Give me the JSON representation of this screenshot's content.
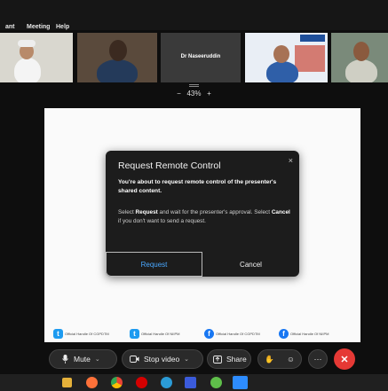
{
  "menu": {
    "items": [
      "ant",
      "Meeting",
      "Help"
    ]
  },
  "participants": [
    {
      "name": "",
      "video": true
    },
    {
      "name": "",
      "video": true
    },
    {
      "name": "Dr Naseeruddin",
      "video": false
    },
    {
      "name": "",
      "video": true
    },
    {
      "name": "",
      "video": true
    }
  ],
  "zoom": {
    "minus": "−",
    "level": "43%",
    "plus": "+"
  },
  "shared_footer": {
    "logos": [
      {
        "icon": "twitter-icon",
        "label": "Official Handle Of CGPDTM"
      },
      {
        "icon": "twitter-icon",
        "label": "Official Handle Of NIIPM"
      },
      {
        "icon": "facebook-icon",
        "label": "Official Handle Of CGPDTM"
      },
      {
        "icon": "facebook-icon",
        "label": "Official Handle Of NIIPM"
      }
    ]
  },
  "dialog": {
    "title": "Request Remote Control",
    "close": "×",
    "lead": "You're about to request remote control of the presenter's shared content.",
    "body_1": "Select",
    "body_request": "Request",
    "body_2": " and wait for the presenter's approval. Select",
    "body_cancel": "Cancel",
    "body_3": " if you don't want to send a request.",
    "request_label": "Request",
    "cancel_label": "Cancel"
  },
  "toolbar": {
    "mute_label": "Mute",
    "stop_video_label": "Stop video",
    "share_label": "Share",
    "more_label": "···",
    "leave_label": "✕"
  },
  "colors": {
    "accent": "#4aa8ff",
    "leave": "#e53935",
    "twitter": "#1d9bf0",
    "facebook": "#1877f2"
  }
}
